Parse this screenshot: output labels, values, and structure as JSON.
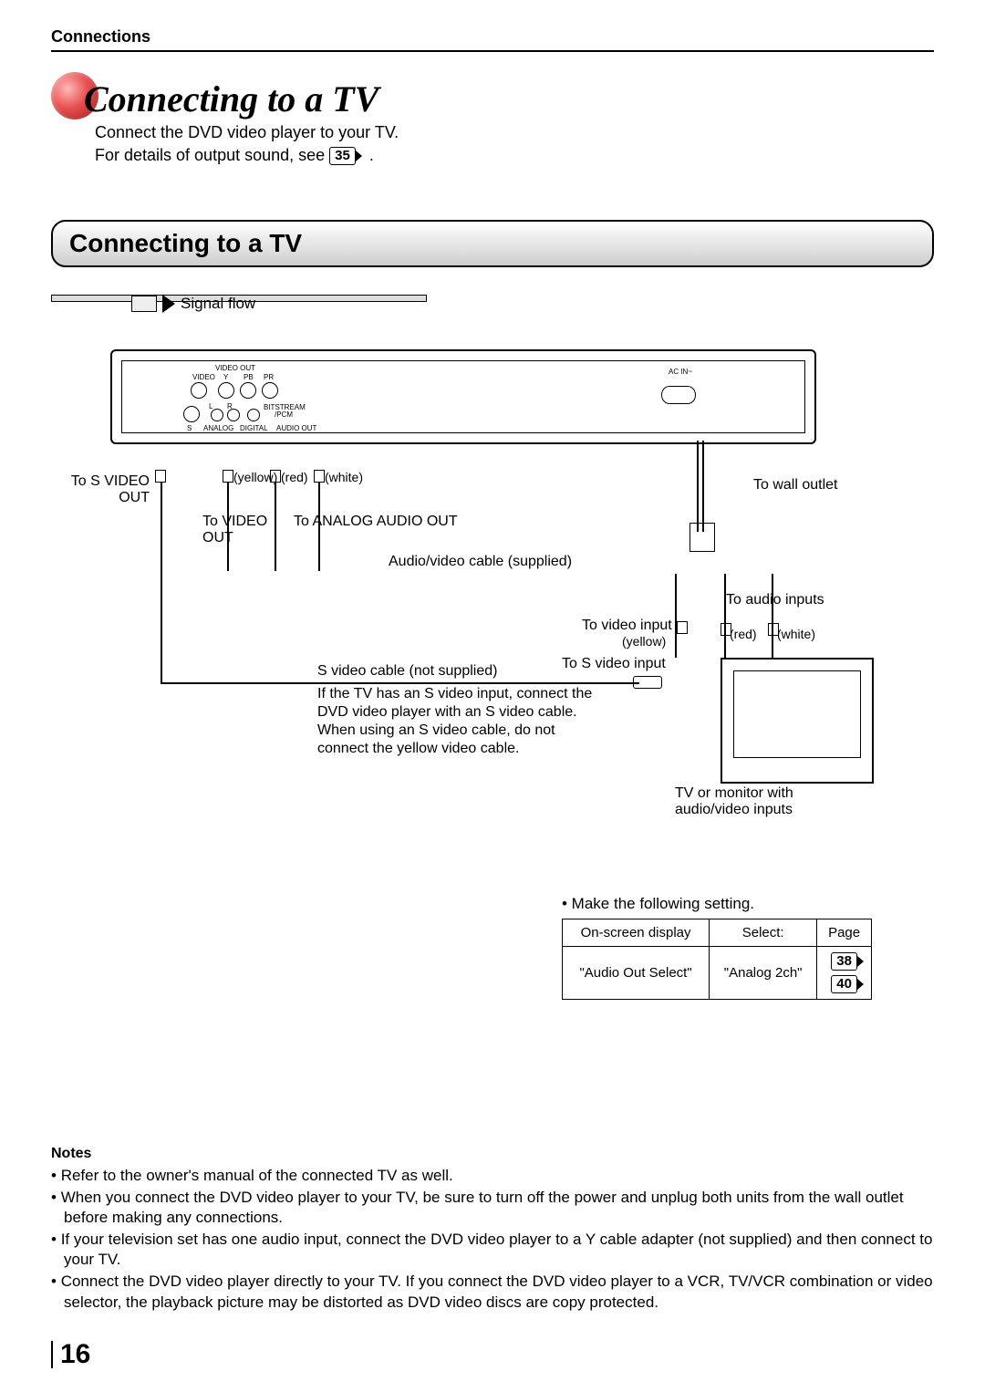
{
  "section_label": "Connections",
  "main_title": "Connecting to a TV",
  "intro": {
    "line1": "Connect the DVD video player to your TV.",
    "line2_prefix": "For details of output sound, see ",
    "line2_ref": "35",
    "line2_suffix": "."
  },
  "subhead": "Connecting to a TV",
  "diagram": {
    "signal_flow": "Signal flow",
    "port_labels": {
      "video_out": "VIDEO OUT",
      "video": "VIDEO",
      "y": "Y",
      "pb": "PB",
      "pr": "PR",
      "bitstream": "BITSTREAM\n/PCM",
      "audio_out": "AUDIO OUT",
      "s": "S",
      "analog_lr": "ANALOG",
      "l": "L",
      "r": "R",
      "digital": "DIGITAL",
      "ac_in": "AC IN~"
    },
    "labels": {
      "to_s_video_out": "To S VIDEO OUT",
      "to_video_out": "To VIDEO OUT",
      "to_analog_audio_out": "To ANALOG AUDIO OUT",
      "yellow": "(yellow)",
      "red": "(red)",
      "white": "(white)",
      "av_cable": "Audio/video cable (supplied)",
      "to_wall_outlet": "To wall outlet",
      "to_audio_inputs": "To audio inputs",
      "to_video_input": "To video input",
      "to_s_video_input": "To S video input",
      "s_cable": "S video cable (not supplied)",
      "s_note": "If the TV has an S video input, connect the DVD video player with an S video cable. When using an S video cable, do not connect the yellow video cable.",
      "tv_caption": "TV or monitor with audio/video inputs"
    }
  },
  "settings": {
    "lead": "• Make the following setting.",
    "headers": {
      "osd": "On-screen display",
      "select": "Select:",
      "page": "Page"
    },
    "row": {
      "osd": "\"Audio Out Select\"",
      "select": "\"Analog 2ch\"",
      "pages": [
        "38",
        "40"
      ]
    }
  },
  "notes": {
    "title": "Notes",
    "items": [
      "Refer to the owner's manual of the connected TV as well.",
      "When you connect the DVD video player to your TV, be sure to turn off the power and unplug both units from the wall outlet before making any connections.",
      "If your television set has one audio input, connect the DVD video player to a Y cable adapter (not supplied) and then connect to your TV.",
      "Connect the DVD video player directly to your TV.  If you connect the DVD video player to a VCR, TV/VCR combination or video selector, the playback picture may be distorted as DVD video discs are copy protected."
    ]
  },
  "page_number": "16"
}
